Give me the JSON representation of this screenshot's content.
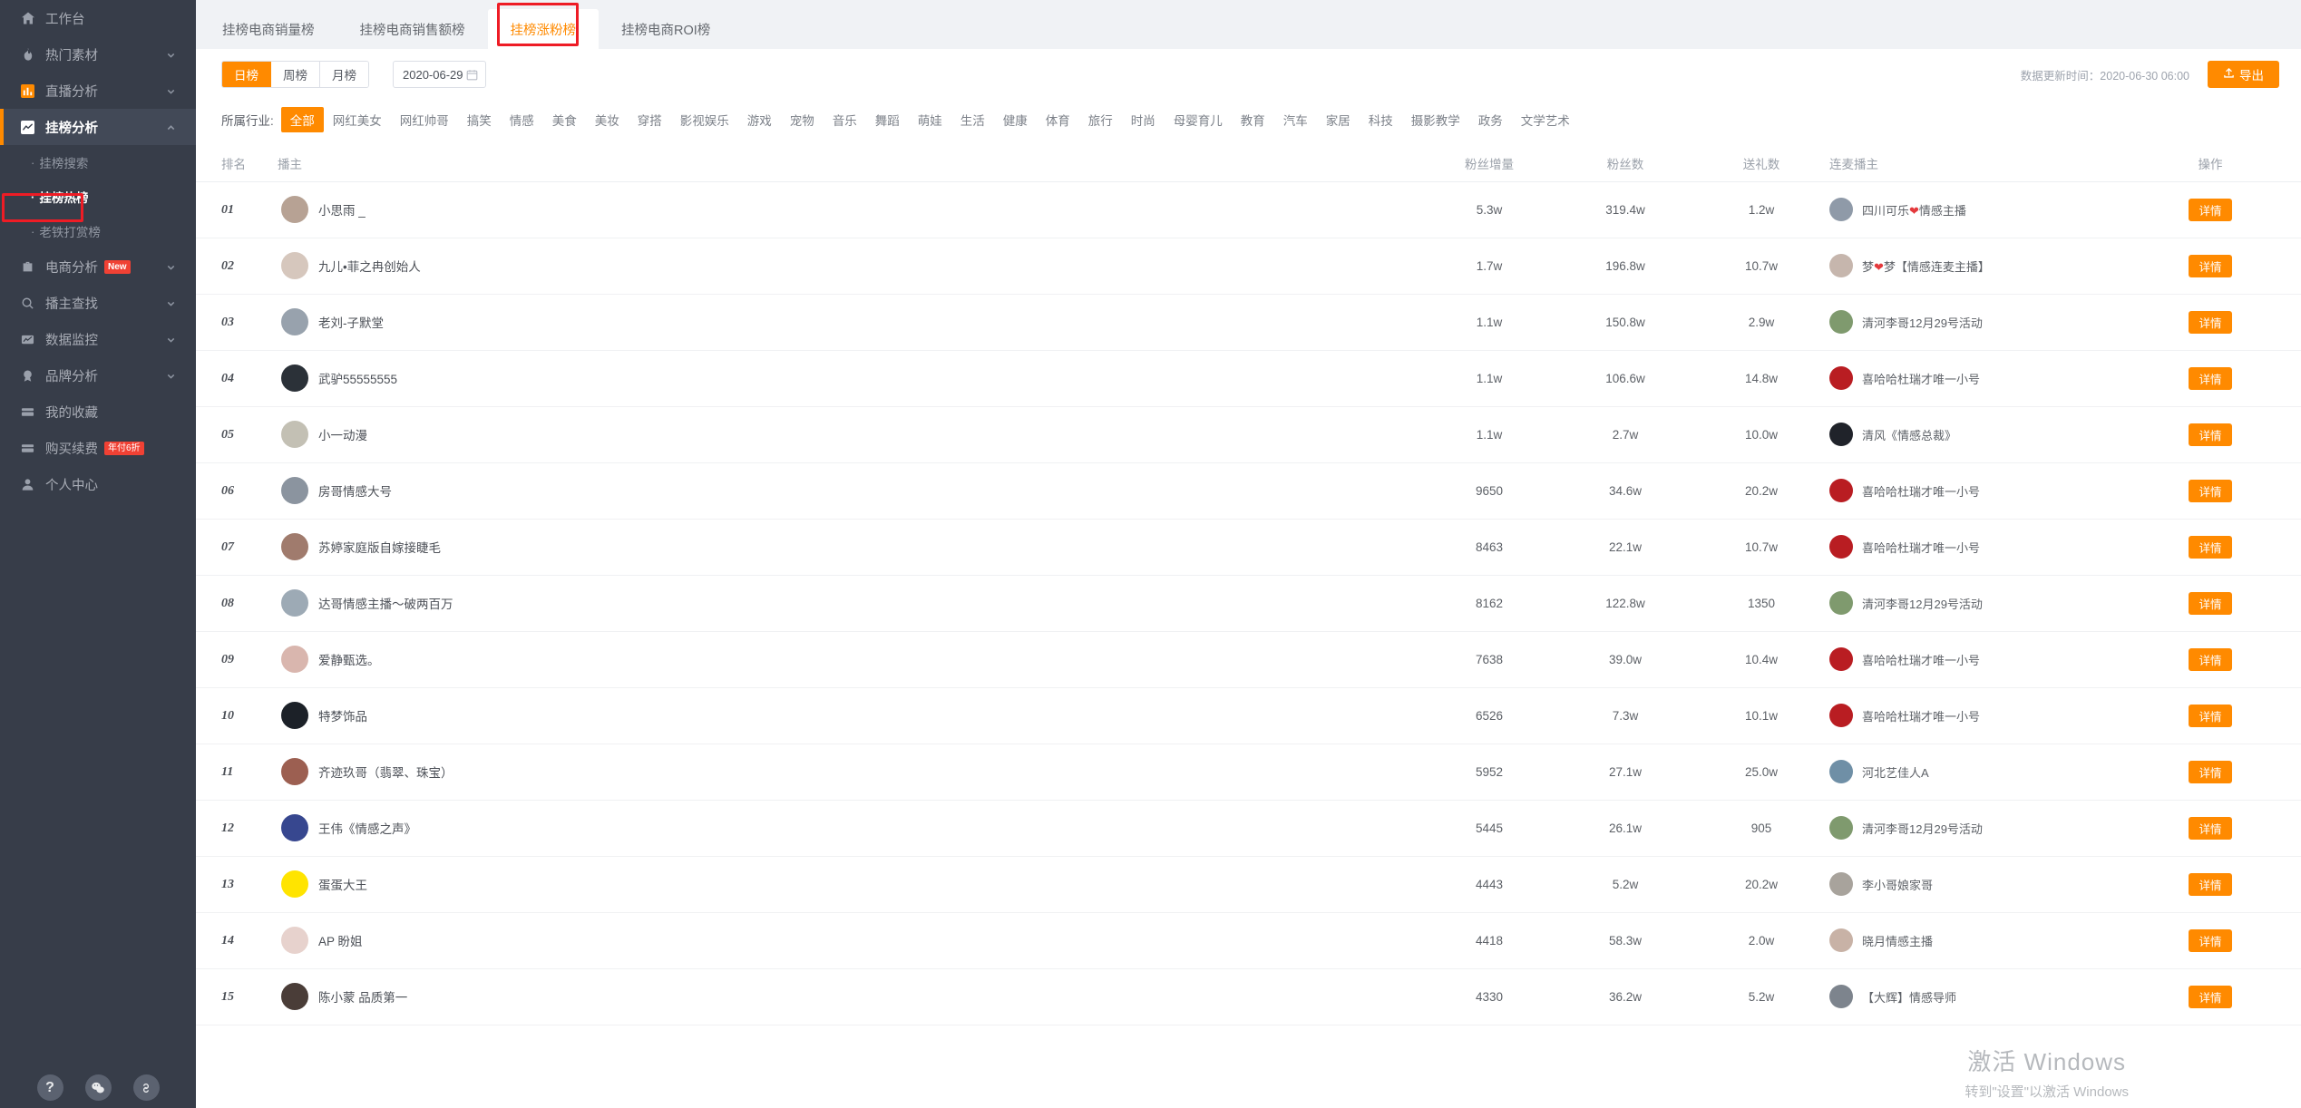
{
  "sidebar": {
    "items": [
      {
        "label": "工作台",
        "icon": "home-icon",
        "expandable": false,
        "active": false
      },
      {
        "label": "热门素材",
        "icon": "fire-icon",
        "expandable": true,
        "active": false
      },
      {
        "label": "直播分析",
        "icon": "bar-chart-icon",
        "expandable": true,
        "active": false
      },
      {
        "label": "挂榜分析",
        "icon": "trend-chart-icon",
        "expandable": true,
        "active": true
      }
    ],
    "sub_items": [
      {
        "label": "挂榜搜索",
        "selected": false
      },
      {
        "label": "挂榜热榜",
        "selected": true
      },
      {
        "label": "老铁打赏榜",
        "selected": false
      }
    ],
    "items_after": [
      {
        "label": "电商分析",
        "icon": "briefcase-icon",
        "expandable": true,
        "badge": "New"
      },
      {
        "label": "播主查找",
        "icon": "search-icon",
        "expandable": true,
        "badge": ""
      },
      {
        "label": "数据监控",
        "icon": "monitor-icon",
        "expandable": true,
        "badge": ""
      },
      {
        "label": "品牌分析",
        "icon": "medal-icon",
        "expandable": true,
        "badge": ""
      },
      {
        "label": "我的收藏",
        "icon": "card-icon",
        "expandable": false,
        "badge": ""
      },
      {
        "label": "购买续费",
        "icon": "card-icon",
        "expandable": false,
        "badge": "年付6折"
      },
      {
        "label": "个人中心",
        "icon": "user-icon",
        "expandable": false,
        "badge": ""
      }
    ],
    "bottom_buttons": [
      {
        "name": "help-icon",
        "glyph": "?"
      },
      {
        "name": "wechat-icon",
        "glyph": ""
      },
      {
        "name": "link-icon",
        "glyph": ""
      }
    ]
  },
  "tabs": [
    {
      "label": "挂榜电商销量榜",
      "active": false
    },
    {
      "label": "挂榜电商销售额榜",
      "active": false
    },
    {
      "label": "挂榜涨粉榜",
      "active": true
    },
    {
      "label": "挂榜电商ROI榜",
      "active": false
    }
  ],
  "toolbar": {
    "period_options": [
      {
        "label": "日榜",
        "active": true
      },
      {
        "label": "周榜",
        "active": false
      },
      {
        "label": "月榜",
        "active": false
      }
    ],
    "date_value": "2020-06-29",
    "update_time_label": "数据更新时间：2020-06-30 06:00",
    "export_label": "导出"
  },
  "industry": {
    "label": "所属行业:",
    "options": [
      {
        "label": "全部",
        "active": true
      },
      {
        "label": "网红美女",
        "active": false
      },
      {
        "label": "网红帅哥",
        "active": false
      },
      {
        "label": "搞笑",
        "active": false
      },
      {
        "label": "情感",
        "active": false
      },
      {
        "label": "美食",
        "active": false
      },
      {
        "label": "美妆",
        "active": false
      },
      {
        "label": "穿搭",
        "active": false
      },
      {
        "label": "影视娱乐",
        "active": false
      },
      {
        "label": "游戏",
        "active": false
      },
      {
        "label": "宠物",
        "active": false
      },
      {
        "label": "音乐",
        "active": false
      },
      {
        "label": "舞蹈",
        "active": false
      },
      {
        "label": "萌娃",
        "active": false
      },
      {
        "label": "生活",
        "active": false
      },
      {
        "label": "健康",
        "active": false
      },
      {
        "label": "体育",
        "active": false
      },
      {
        "label": "旅行",
        "active": false
      },
      {
        "label": "时尚",
        "active": false
      },
      {
        "label": "母婴育儿",
        "active": false
      },
      {
        "label": "教育",
        "active": false
      },
      {
        "label": "汽车",
        "active": false
      },
      {
        "label": "家居",
        "active": false
      },
      {
        "label": "科技",
        "active": false
      },
      {
        "label": "摄影教学",
        "active": false
      },
      {
        "label": "政务",
        "active": false
      },
      {
        "label": "文学艺术",
        "active": false
      }
    ]
  },
  "table": {
    "columns": [
      {
        "key": "rank",
        "label": "排名"
      },
      {
        "key": "host",
        "label": "播主"
      },
      {
        "key": "fans_growth",
        "label": "粉丝增量"
      },
      {
        "key": "fans_total",
        "label": "粉丝数"
      },
      {
        "key": "gifts",
        "label": "送礼数"
      },
      {
        "key": "mate",
        "label": "连麦播主"
      },
      {
        "key": "op",
        "label": "操作"
      }
    ],
    "detail_label": "详情",
    "rows": [
      {
        "rank": "01",
        "host": "小思雨 _",
        "avatar_color": "#b7a294",
        "fans_growth": "5.3w",
        "fans_total": "319.4w",
        "gifts": "1.2w",
        "mate": "四川可乐❤情感主播",
        "mate_avatar_color": "#8f9aa8"
      },
      {
        "rank": "02",
        "host": "九儿•菲之冉创始人",
        "avatar_color": "#d6c7bd",
        "fans_growth": "1.7w",
        "fans_total": "196.8w",
        "gifts": "10.7w",
        "mate": "梦❤梦【情感连麦主播】",
        "mate_avatar_color": "#c6b6ad"
      },
      {
        "rank": "03",
        "host": "老刘-子默堂",
        "avatar_color": "#98a2ad",
        "fans_growth": "1.1w",
        "fans_total": "150.8w",
        "gifts": "2.9w",
        "mate": "清河李哥12月29号活动",
        "mate_avatar_color": "#7f9a6e"
      },
      {
        "rank": "04",
        "host": "武驴55555555",
        "avatar_color": "#2b3138",
        "fans_growth": "1.1w",
        "fans_total": "106.6w",
        "gifts": "14.8w",
        "mate": "喜哈哈杜瑞才唯一小号",
        "mate_avatar_color": "#b91d22"
      },
      {
        "rank": "05",
        "host": "小一动漫",
        "avatar_color": "#c3c0b4",
        "fans_growth": "1.1w",
        "fans_total": "2.7w",
        "gifts": "10.0w",
        "mate": "清风《情感总裁》",
        "mate_avatar_color": "#20232a"
      },
      {
        "rank": "06",
        "host": "房哥情感大号",
        "avatar_color": "#8b949f",
        "fans_growth": "9650",
        "fans_total": "34.6w",
        "gifts": "20.2w",
        "mate": "喜哈哈杜瑞才唯一小号",
        "mate_avatar_color": "#b91d22"
      },
      {
        "rank": "07",
        "host": "苏婷家庭版自嫁接睫毛",
        "avatar_color": "#a07b6d",
        "fans_growth": "8463",
        "fans_total": "22.1w",
        "gifts": "10.7w",
        "mate": "喜哈哈杜瑞才唯一小号",
        "mate_avatar_color": "#b91d22"
      },
      {
        "rank": "08",
        "host": "达哥情感主播～破两百万",
        "avatar_color": "#9daab5",
        "fans_growth": "8162",
        "fans_total": "122.8w",
        "gifts": "1350",
        "mate": "清河李哥12月29号活动",
        "mate_avatar_color": "#7f9a6e"
      },
      {
        "rank": "09",
        "host": "爱静甄选。",
        "avatar_color": "#d9b6ae",
        "fans_growth": "7638",
        "fans_total": "39.0w",
        "gifts": "10.4w",
        "mate": "喜哈哈杜瑞才唯一小号",
        "mate_avatar_color": "#b91d22"
      },
      {
        "rank": "10",
        "host": "特梦饰品",
        "avatar_color": "#1c2128",
        "fans_growth": "6526",
        "fans_total": "7.3w",
        "gifts": "10.1w",
        "mate": "喜哈哈杜瑞才唯一小号",
        "mate_avatar_color": "#b91d22"
      },
      {
        "rank": "11",
        "host": "齐迹玖哥（翡翠、珠宝）",
        "avatar_color": "#9c5f51",
        "fans_growth": "5952",
        "fans_total": "27.1w",
        "gifts": "25.0w",
        "mate": "河北艺佳人A",
        "mate_avatar_color": "#6f8fa6"
      },
      {
        "rank": "12",
        "host": "王伟《情感之声》",
        "avatar_color": "#37478f",
        "fans_growth": "5445",
        "fans_total": "26.1w",
        "gifts": "905",
        "mate": "清河李哥12月29号活动",
        "mate_avatar_color": "#7f9a6e"
      },
      {
        "rank": "13",
        "host": "蛋蛋大王",
        "avatar_color": "#ffe400",
        "fans_growth": "4443",
        "fans_total": "5.2w",
        "gifts": "20.2w",
        "mate": "李小哥娘家哥",
        "mate_avatar_color": "#a8a39c"
      },
      {
        "rank": "14",
        "host": "AP 盼姐",
        "avatar_color": "#e7d2cd",
        "fans_growth": "4418",
        "fans_total": "58.3w",
        "gifts": "2.0w",
        "mate": "晓月情感主播",
        "mate_avatar_color": "#c8b2a6"
      },
      {
        "rank": "15",
        "host": "陈小蒙 品质第一",
        "avatar_color": "#4a3d38",
        "fans_growth": "4330",
        "fans_total": "36.2w",
        "gifts": "5.2w",
        "mate": "【大辉】情感导师",
        "mate_avatar_color": "#7d848d"
      }
    ]
  },
  "watermark": {
    "line1": "激活 Windows",
    "line2": "转到\"设置\"以激活 Windows"
  },
  "colors": {
    "accent": "#ff8a00",
    "sidebar_bg": "#373d49",
    "sidebar_active_bg": "#424957",
    "annotation_red": "#ee1c25",
    "page_bg": "#f0f2f5"
  }
}
